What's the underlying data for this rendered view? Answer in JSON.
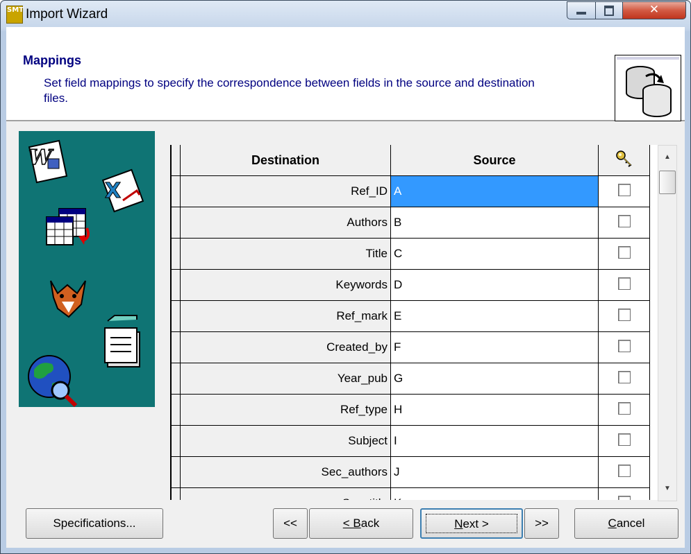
{
  "window": {
    "title": "Import Wizard",
    "app_icon_text": "SMT"
  },
  "header": {
    "title": "Mappings",
    "description": "Set field mappings to specify the correspondence between fields in the source and destination files."
  },
  "grid": {
    "columns": {
      "destination": "Destination",
      "source": "Source",
      "key_icon": "key-icon"
    },
    "rows": [
      {
        "destination": "Ref_ID",
        "source": "A",
        "selected": true,
        "key_checked": false
      },
      {
        "destination": "Authors",
        "source": "B",
        "key_checked": false
      },
      {
        "destination": "Title",
        "source": "C",
        "key_checked": false
      },
      {
        "destination": "Keywords",
        "source": "D",
        "key_checked": false
      },
      {
        "destination": "Ref_mark",
        "source": "E",
        "key_checked": false
      },
      {
        "destination": "Created_by",
        "source": "F",
        "key_checked": false
      },
      {
        "destination": "Year_pub",
        "source": "G",
        "key_checked": false
      },
      {
        "destination": "Ref_type",
        "source": "H",
        "key_checked": false
      },
      {
        "destination": "Subject",
        "source": "I",
        "key_checked": false
      },
      {
        "destination": "Sec_authors",
        "source": "J",
        "key_checked": false
      },
      {
        "destination": "Sec_title",
        "source": "K",
        "key_checked": false
      }
    ]
  },
  "buttons": {
    "specifications": "Specifications...",
    "first": "<<",
    "back": "< Back",
    "next": "Next >",
    "last": ">>",
    "cancel": "Cancel"
  },
  "side_icons": [
    "word-document-icon",
    "excel-document-icon",
    "table-convert-icon",
    "fox-icon",
    "notepad-icon",
    "globe-search-icon"
  ]
}
